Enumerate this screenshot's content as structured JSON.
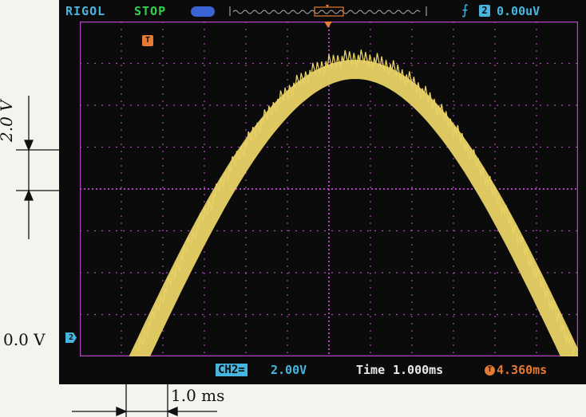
{
  "scope": {
    "brand": "RIGOL",
    "run_status": "STOP",
    "trigger_level": "0.00uV",
    "trigger_source_badge": "2",
    "trigger_position_marker": "T",
    "ch2_ground_marker": "2",
    "channel_badge": "CH2=",
    "channel_scale": "2.00V",
    "time_label": "Time",
    "time_scale": "1.000ms",
    "trigger_offset": "4.360ms",
    "icons": {
      "trigger_mode": "trigger-edge-icon",
      "channel_indicator": "channel-pill-icon"
    }
  },
  "annotations": {
    "volts_per_div": "2.0 V",
    "zero_level": "0.0 V",
    "time_per_div": "1.0 ms"
  },
  "colors": {
    "trace": "#e8d266",
    "grid": "#b343c1",
    "cyan": "#46b6e0",
    "orange": "#e47a33"
  }
}
